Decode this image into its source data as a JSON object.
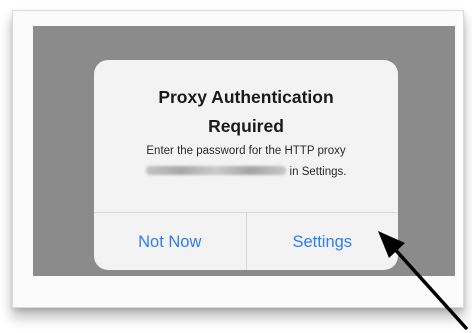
{
  "alert": {
    "title": "Proxy Authentication\nRequired",
    "message_line1": "Enter the password for the HTTP proxy",
    "message_line2_suffix": "in Settings.",
    "buttons": {
      "not_now": "Not Now",
      "settings": "Settings"
    }
  },
  "colors": {
    "button_text": "#2f7ef0",
    "screen_dim": "#8b8b8b",
    "alert_bg": "#f3f3f3",
    "arrow": "#000000"
  },
  "icons": {
    "pointer_arrow": "arrow-pointing-to-settings"
  }
}
